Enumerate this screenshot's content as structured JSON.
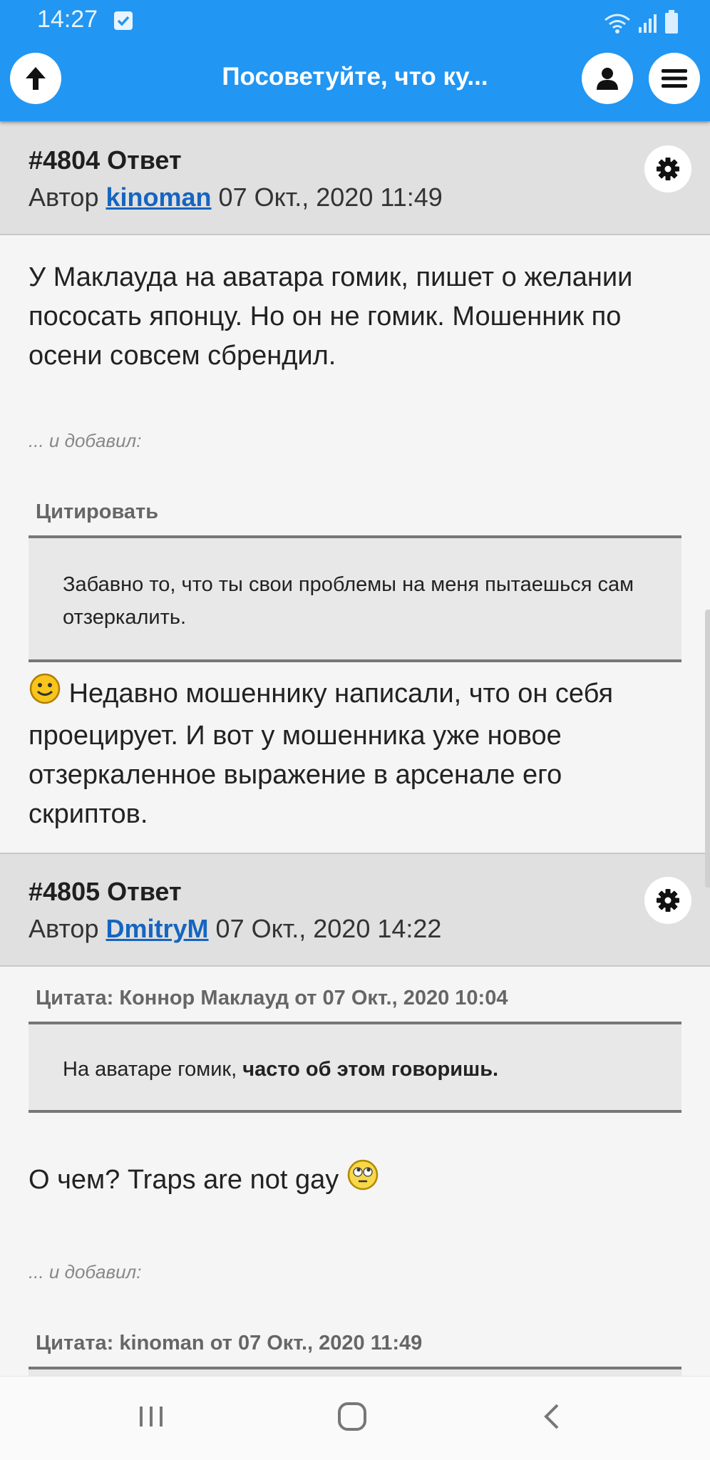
{
  "status": {
    "time": "14:27"
  },
  "header": {
    "title": "Посоветуйте, что ку..."
  },
  "icons": {
    "back": "arrow-up-icon",
    "profile": "user-icon",
    "menu": "hamburger-icon",
    "gear": "gear-icon",
    "smile": "smiley-icon"
  },
  "colors": {
    "accent": "#2196f3",
    "link": "#1565c0"
  },
  "posts": [
    {
      "number": "#4804 Ответ",
      "author_prefix": "Автор",
      "author": "kinoman",
      "date": "07 Окт., 2020 11:49",
      "text1": "У Маклауда на аватара гомик, пишет о желании пососать японцу. Но он не гомик. Мошенник по осени совсем сбрендил.",
      "added": "... и добавил:",
      "quote_label": "Цитировать",
      "quote_text": "Забавно то, что ты свои проблемы на меня пытаешься сам отзеркалить.",
      "text2": "Недавно мошеннику написали, что он себя проецирует. И вот у мошенника уже новое отзеркаленное выражение в арсенале его скриптов."
    },
    {
      "number": "#4805 Ответ",
      "author_prefix": "Автор",
      "author": "DmitryM",
      "date": "07 Окт., 2020 14:22",
      "quote_label": "Цитата: Коннор Маклауд от 07 Окт., 2020 10:04",
      "quote_text_plain": "На аватаре гомик, ",
      "quote_text_bold": "часто об этом говоришь.",
      "text1": "О чем? Traps are not gay",
      "added": "... и добавил:",
      "quote2_label": "Цитата: kinoman от 07 Окт., 2020 11:49"
    }
  ],
  "navbar": {
    "recent": "recent-apps-icon",
    "home": "home-icon",
    "back": "back-icon"
  }
}
